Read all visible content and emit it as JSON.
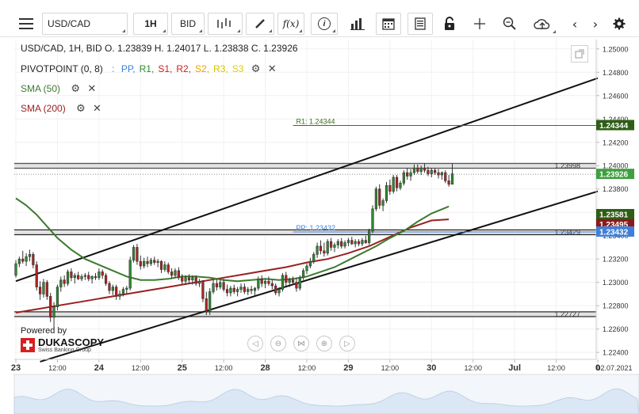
{
  "toolbar": {
    "symbol": "USD/CAD",
    "timeframe": "1H",
    "price_side": "BID",
    "indicators_icon": "indicator-bars-icon",
    "draw_icon": "pencil-icon",
    "formula_label": "f(x)",
    "info_label": "i",
    "volume_icon": "volume-bars-icon",
    "calendar_icon": "calendar-icon",
    "report_icon": "report-icon",
    "lock_icon": "lock-icon",
    "crosshair_icon": "crosshair-icon",
    "zoom_icon": "zoom-icon",
    "upload_icon": "cloud-upload-icon",
    "prev_label": "‹",
    "next_label": "›",
    "settings_icon": "gear-icon"
  },
  "legend": {
    "ohlc": "USD/CAD, 1H, BID    O. 1.23839 H. 1.24017 L. 1.23838 C. 1.23926",
    "pivot_title": "PIVOTPOINT (0, 8)",
    "pivot_items": [
      {
        "label": "PP,",
        "color": "#3f7fd8"
      },
      {
        "label": "R1,",
        "color": "#2e8b2e"
      },
      {
        "label": "S1,",
        "color": "#cc2020"
      },
      {
        "label": "R2,",
        "color": "#cc2020"
      },
      {
        "label": "S2,",
        "color": "#f0a000"
      },
      {
        "label": "R3,",
        "color": "#d4c400"
      },
      {
        "label": "S3",
        "color": "#e0d000"
      }
    ],
    "sma50": "SMA (50)",
    "sma200": "SMA (200)"
  },
  "colors": {
    "bull": "#2e8b2e",
    "bear": "#b22222",
    "sma50": "#3d7a2f",
    "sma200": "#9b2020",
    "channel": "#111111",
    "pp": "#3f7fd8",
    "r1": "#3b6e20"
  },
  "chart_data": {
    "type": "candlestick",
    "symbol": "USD/CAD",
    "timeframe": "1H",
    "ylim": [
      1.2234,
      1.2508
    ],
    "y_ticks": [
      1.25,
      1.248,
      1.246,
      1.244,
      1.242,
      1.24,
      1.238,
      1.236,
      1.234,
      1.232,
      1.23,
      1.228,
      1.226,
      1.224
    ],
    "x_ticks": [
      {
        "label": "23",
        "i": 0
      },
      {
        "label": "12:00",
        "i": 12
      },
      {
        "label": "24",
        "i": 24
      },
      {
        "label": "12:00",
        "i": 36
      },
      {
        "label": "25",
        "i": 48
      },
      {
        "label": "12:00",
        "i": 60
      },
      {
        "label": "28",
        "i": 72
      },
      {
        "label": "12:00",
        "i": 84
      },
      {
        "label": "29",
        "i": 96
      },
      {
        "label": "12:00",
        "i": 108
      },
      {
        "label": "30",
        "i": 120
      },
      {
        "label": "12:00",
        "i": 132
      },
      {
        "label": "Jul",
        "i": 144
      },
      {
        "label": "12:00",
        "i": 156
      },
      {
        "label": "0",
        "i": 168
      }
    ],
    "date_label": "02.07.2021",
    "last_index": 167,
    "candles": [
      [
        1.2306,
        1.2319,
        1.2304,
        1.2316
      ],
      [
        1.2316,
        1.2322,
        1.2313,
        1.232
      ],
      [
        1.232,
        1.2327,
        1.2316,
        1.2318
      ],
      [
        1.2318,
        1.2325,
        1.2314,
        1.2322
      ],
      [
        1.2322,
        1.2328,
        1.2318,
        1.2324
      ],
      [
        1.2324,
        1.2326,
        1.2312,
        1.2315
      ],
      [
        1.2315,
        1.2318,
        1.2293,
        1.2296
      ],
      [
        1.2296,
        1.2301,
        1.2285,
        1.229
      ],
      [
        1.229,
        1.2303,
        1.2287,
        1.23
      ],
      [
        1.23,
        1.2302,
        1.2285,
        1.2288
      ],
      [
        1.2288,
        1.2291,
        1.2266,
        1.227
      ],
      [
        1.227,
        1.2283,
        1.226,
        1.2279
      ],
      [
        1.2279,
        1.2298,
        1.2276,
        1.2296
      ],
      [
        1.2296,
        1.2305,
        1.2292,
        1.2302
      ],
      [
        1.2302,
        1.2306,
        1.2296,
        1.2299
      ],
      [
        1.2299,
        1.2311,
        1.2297,
        1.2309
      ],
      [
        1.2309,
        1.2312,
        1.2301,
        1.2304
      ],
      [
        1.2304,
        1.2308,
        1.2299,
        1.2306
      ],
      [
        1.2306,
        1.2309,
        1.2302,
        1.2303
      ],
      [
        1.2303,
        1.2307,
        1.2301,
        1.2305
      ],
      [
        1.2305,
        1.2308,
        1.2302,
        1.2306
      ],
      [
        1.2306,
        1.2309,
        1.2301,
        1.2303
      ],
      [
        1.2303,
        1.2306,
        1.2299,
        1.2305
      ],
      [
        1.2305,
        1.2308,
        1.2302,
        1.2304
      ],
      [
        1.2304,
        1.2312,
        1.2302,
        1.2309
      ],
      [
        1.2309,
        1.2311,
        1.2303,
        1.2306
      ],
      [
        1.2306,
        1.2308,
        1.2297,
        1.2299
      ],
      [
        1.2299,
        1.2301,
        1.229,
        1.2293
      ],
      [
        1.2293,
        1.2298,
        1.2289,
        1.2296
      ],
      [
        1.2296,
        1.2298,
        1.2285,
        1.2288
      ],
      [
        1.2288,
        1.2293,
        1.2285,
        1.229
      ],
      [
        1.229,
        1.2296,
        1.2288,
        1.2294
      ],
      [
        1.2294,
        1.2297,
        1.229,
        1.2295
      ],
      [
        1.2295,
        1.2322,
        1.2293,
        1.2319
      ],
      [
        1.2319,
        1.2332,
        1.2317,
        1.233
      ],
      [
        1.233,
        1.2333,
        1.2315,
        1.2318
      ],
      [
        1.2318,
        1.2323,
        1.2311,
        1.2314
      ],
      [
        1.2314,
        1.2321,
        1.2312,
        1.2318
      ],
      [
        1.2318,
        1.2322,
        1.2313,
        1.2316
      ],
      [
        1.2316,
        1.2321,
        1.2314,
        1.2319
      ],
      [
        1.2319,
        1.2322,
        1.2315,
        1.2317
      ],
      [
        1.2317,
        1.232,
        1.2313,
        1.2318
      ],
      [
        1.2318,
        1.2319,
        1.2308,
        1.2311
      ],
      [
        1.2311,
        1.2318,
        1.2309,
        1.2315
      ],
      [
        1.2315,
        1.2317,
        1.2307,
        1.2309
      ],
      [
        1.2309,
        1.2312,
        1.2303,
        1.2306
      ],
      [
        1.2306,
        1.2312,
        1.2304,
        1.231
      ],
      [
        1.231,
        1.2313,
        1.2302,
        1.2304
      ],
      [
        1.2304,
        1.2307,
        1.2298,
        1.2301
      ],
      [
        1.2301,
        1.2306,
        1.2298,
        1.2304
      ],
      [
        1.2304,
        1.2307,
        1.2299,
        1.2302
      ],
      [
        1.2302,
        1.2306,
        1.2298,
        1.2304
      ],
      [
        1.2304,
        1.2306,
        1.2297,
        1.2299
      ],
      [
        1.2299,
        1.2303,
        1.2296,
        1.2301
      ],
      [
        1.2301,
        1.2302,
        1.2283,
        1.2286
      ],
      [
        1.2286,
        1.2292,
        1.2272,
        1.2275
      ],
      [
        1.2275,
        1.2295,
        1.2272,
        1.2292
      ],
      [
        1.2292,
        1.2302,
        1.229,
        1.2299
      ],
      [
        1.2299,
        1.2303,
        1.2293,
        1.2296
      ],
      [
        1.2296,
        1.2302,
        1.2294,
        1.23
      ],
      [
        1.23,
        1.2303,
        1.2292,
        1.2294
      ],
      [
        1.2294,
        1.2298,
        1.2288,
        1.2291
      ],
      [
        1.2291,
        1.2297,
        1.2288,
        1.2295
      ],
      [
        1.2295,
        1.2298,
        1.229,
        1.2292
      ],
      [
        1.2292,
        1.2296,
        1.2288,
        1.2294
      ],
      [
        1.2294,
        1.2299,
        1.2291,
        1.2296
      ],
      [
        1.2296,
        1.2299,
        1.229,
        1.2292
      ],
      [
        1.2292,
        1.2296,
        1.2289,
        1.2294
      ],
      [
        1.2294,
        1.2297,
        1.229,
        1.2293
      ],
      [
        1.2293,
        1.2296,
        1.2289,
        1.2295
      ],
      [
        1.2295,
        1.2305,
        1.2293,
        1.2303
      ],
      [
        1.2303,
        1.2306,
        1.2296,
        1.2299
      ],
      [
        1.2299,
        1.2303,
        1.2295,
        1.2301
      ],
      [
        1.2301,
        1.2305,
        1.2297,
        1.2299
      ],
      [
        1.2299,
        1.2302,
        1.2294,
        1.2297
      ],
      [
        1.2297,
        1.2299,
        1.2289,
        1.2291
      ],
      [
        1.2291,
        1.2296,
        1.2288,
        1.2294
      ],
      [
        1.2294,
        1.2308,
        1.2292,
        1.2306
      ],
      [
        1.2306,
        1.2309,
        1.2297,
        1.23
      ],
      [
        1.23,
        1.2304,
        1.2296,
        1.2302
      ],
      [
        1.2302,
        1.2305,
        1.2298,
        1.23
      ],
      [
        1.23,
        1.2304,
        1.2292,
        1.2295
      ],
      [
        1.2295,
        1.2306,
        1.2293,
        1.2304
      ],
      [
        1.2304,
        1.2312,
        1.2302,
        1.231
      ],
      [
        1.231,
        1.2316,
        1.2307,
        1.2314
      ],
      [
        1.2314,
        1.2321,
        1.2312,
        1.2318
      ],
      [
        1.2318,
        1.2326,
        1.2316,
        1.2324
      ],
      [
        1.2324,
        1.2334,
        1.2321,
        1.2331
      ],
      [
        1.2331,
        1.2336,
        1.2324,
        1.2327
      ],
      [
        1.2327,
        1.2334,
        1.2322,
        1.2325
      ],
      [
        1.2325,
        1.2337,
        1.2323,
        1.2335
      ],
      [
        1.2335,
        1.2338,
        1.2327,
        1.233
      ],
      [
        1.233,
        1.2334,
        1.2326,
        1.2332
      ],
      [
        1.2332,
        1.2337,
        1.2329,
        1.2335
      ],
      [
        1.2335,
        1.2338,
        1.2329,
        1.2331
      ],
      [
        1.2331,
        1.2336,
        1.2329,
        1.2334
      ],
      [
        1.2334,
        1.2338,
        1.2331,
        1.2336
      ],
      [
        1.2336,
        1.2339,
        1.2332,
        1.2333
      ],
      [
        1.2333,
        1.2337,
        1.233,
        1.2335
      ],
      [
        1.2335,
        1.2337,
        1.2331,
        1.2333
      ],
      [
        1.2333,
        1.2338,
        1.2331,
        1.2336
      ],
      [
        1.2336,
        1.234,
        1.2333,
        1.2334
      ],
      [
        1.2334,
        1.2346,
        1.2332,
        1.2344
      ],
      [
        1.2344,
        1.2366,
        1.2342,
        1.2363
      ],
      [
        1.2363,
        1.2382,
        1.2361,
        1.238
      ],
      [
        1.238,
        1.2384,
        1.2363,
        1.2366
      ],
      [
        1.2366,
        1.2372,
        1.2361,
        1.237
      ],
      [
        1.237,
        1.2386,
        1.2368,
        1.2383
      ],
      [
        1.2383,
        1.2388,
        1.2375,
        1.2378
      ],
      [
        1.2378,
        1.2392,
        1.2376,
        1.239
      ],
      [
        1.239,
        1.2392,
        1.2378,
        1.2381
      ],
      [
        1.2381,
        1.2387,
        1.2379,
        1.2385
      ],
      [
        1.2385,
        1.2396,
        1.2383,
        1.2394
      ],
      [
        1.2394,
        1.2398,
        1.2388,
        1.2391
      ],
      [
        1.2391,
        1.2397,
        1.2387,
        1.2394
      ],
      [
        1.2394,
        1.2401,
        1.2392,
        1.2398
      ],
      [
        1.2398,
        1.2401,
        1.2393,
        1.2395
      ],
      [
        1.2395,
        1.24,
        1.2392,
        1.2398
      ],
      [
        1.2398,
        1.2402,
        1.2394,
        1.2396
      ],
      [
        1.2396,
        1.2399,
        1.2391,
        1.2393
      ],
      [
        1.2393,
        1.2398,
        1.239,
        1.2396
      ],
      [
        1.2396,
        1.2398,
        1.2392,
        1.2394
      ],
      [
        1.2394,
        1.2397,
        1.2389,
        1.2392
      ],
      [
        1.2392,
        1.2395,
        1.2388,
        1.2394
      ],
      [
        1.2394,
        1.2396,
        1.2385,
        1.2387
      ],
      [
        1.2387,
        1.2392,
        1.2382,
        1.2384
      ],
      [
        1.2384,
        1.2402,
        1.2384,
        1.2393
      ]
    ],
    "sma50": [
      [
        0,
        1.2372
      ],
      [
        3,
        1.2366
      ],
      [
        6,
        1.2358
      ],
      [
        9,
        1.2348
      ],
      [
        12,
        1.2338
      ],
      [
        16,
        1.2328
      ],
      [
        20,
        1.232
      ],
      [
        24,
        1.2315
      ],
      [
        28,
        1.231
      ],
      [
        32,
        1.2305
      ],
      [
        36,
        1.2302
      ],
      [
        40,
        1.2302
      ],
      [
        44,
        1.2303
      ],
      [
        48,
        1.2305
      ],
      [
        52,
        1.2305
      ],
      [
        56,
        1.2304
      ],
      [
        60,
        1.2302
      ],
      [
        64,
        1.2301
      ],
      [
        68,
        1.2302
      ],
      [
        72,
        1.2303
      ],
      [
        76,
        1.2302
      ],
      [
        80,
        1.2303
      ],
      [
        84,
        1.2305
      ],
      [
        88,
        1.2309
      ],
      [
        92,
        1.2313
      ],
      [
        96,
        1.2319
      ],
      [
        100,
        1.2325
      ],
      [
        104,
        1.2331
      ],
      [
        108,
        1.2338
      ],
      [
        112,
        1.2344
      ],
      [
        116,
        1.2352
      ],
      [
        120,
        1.2359
      ],
      [
        125,
        1.2365
      ]
    ],
    "sma200": [
      [
        0,
        1.2274
      ],
      [
        6,
        1.2277
      ],
      [
        12,
        1.228
      ],
      [
        18,
        1.2283
      ],
      [
        24,
        1.2286
      ],
      [
        30,
        1.2289
      ],
      [
        36,
        1.2292
      ],
      [
        42,
        1.2295
      ],
      [
        48,
        1.2298
      ],
      [
        54,
        1.2301
      ],
      [
        60,
        1.2304
      ],
      [
        66,
        1.2307
      ],
      [
        72,
        1.231
      ],
      [
        78,
        1.2313
      ],
      [
        84,
        1.2317
      ],
      [
        90,
        1.232
      ],
      [
        96,
        1.2325
      ],
      [
        102,
        1.2331
      ],
      [
        108,
        1.2339
      ],
      [
        114,
        1.2347
      ],
      [
        120,
        1.2353
      ],
      [
        125,
        1.2354
      ]
    ],
    "h_lines": [
      {
        "value": 1.23998,
        "label": "1.23998",
        "color": "#555555",
        "band": true
      },
      {
        "value": 1.23429,
        "label": "1.23429",
        "color": "#222222",
        "band": true
      },
      {
        "value": 1.22727,
        "label": "1.22727",
        "color": "#222222",
        "band": true
      }
    ],
    "pivot_lines": [
      {
        "name": "R1",
        "value": 1.24344,
        "label": "R1: 1.24344",
        "color": "#3b6e20",
        "x_start": 80
      },
      {
        "name": "PP",
        "value": 1.23432,
        "label": "PP: 1.23432",
        "color": "#3f7fd8",
        "x_start": 80
      }
    ],
    "current_price_line": {
      "value": 1.23926
    },
    "channel_lines": [
      {
        "i1": 0,
        "v1": 1.2301,
        "i2": 168,
        "v2": 1.2475
      },
      {
        "i1": 7,
        "v1": 1.2232,
        "i2": 168,
        "v2": 1.2378
      }
    ],
    "price_tags": [
      {
        "value": 1.24344,
        "label": "1.24344",
        "bg": "#2e5e16",
        "color": "#ffffff"
      },
      {
        "value": 1.23926,
        "label": "1.23926",
        "bg": "#3f9f3f",
        "color": "#ffffff"
      },
      {
        "value": 1.23581,
        "label": "1.23581",
        "bg": "#2e5e16",
        "color": "#ffffff"
      },
      {
        "value": 1.23495,
        "label": "1.23495",
        "bg": "#8b1a1a",
        "color": "#ffffff"
      },
      {
        "value": 1.23432,
        "label": "1.23432",
        "bg": "#3f7fd8",
        "color": "#ffffff"
      }
    ],
    "logo_text": "Powered by",
    "logo_brand": "DUKASCOPY",
    "logo_sub": "Swiss Banking Group"
  }
}
